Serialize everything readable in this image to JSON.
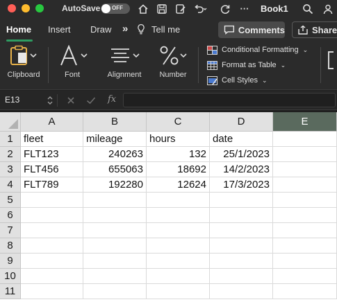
{
  "titlebar": {
    "autosave_label": "AutoSave",
    "autosave_state": "OFF",
    "more": "···",
    "doc_title": "Book1",
    "icons": [
      "home-icon",
      "save-icon",
      "edit-icon",
      "undo-icon",
      "redo-icon",
      "search-icon"
    ]
  },
  "tabs": {
    "home": "Home",
    "insert": "Insert",
    "draw": "Draw",
    "overflow": "»",
    "tell_me": "Tell me",
    "comments": "Comments",
    "share": "Share"
  },
  "ribbon": {
    "clipboard": "Clipboard",
    "font": "Font",
    "alignment": "Alignment",
    "number": "Number",
    "conditional_formatting": "Conditional Formatting",
    "format_as_table": "Format as Table",
    "cell_styles": "Cell Styles"
  },
  "formula_bar": {
    "name_box": "E13",
    "fx": "fx",
    "value": ""
  },
  "sheet": {
    "columns": [
      "A",
      "B",
      "C",
      "D",
      "E"
    ],
    "selected_column": "E",
    "row_numbers": [
      "1",
      "2",
      "3",
      "4",
      "5",
      "6",
      "7",
      "8",
      "9",
      "10",
      "11"
    ],
    "rows": [
      [
        "fleet",
        "mileage",
        "hours",
        "date",
        ""
      ],
      [
        "FLT123",
        "240263",
        "132",
        "25/1/2023",
        ""
      ],
      [
        "FLT456",
        "655063",
        "18692",
        "14/2/2023",
        ""
      ],
      [
        "FLT789",
        "192280",
        "12624",
        "17/3/2023",
        ""
      ]
    ]
  },
  "colors": {
    "accent": "#2e9d62",
    "chrome": "#2b2b2b",
    "selected_header": "#5a6a5e"
  }
}
